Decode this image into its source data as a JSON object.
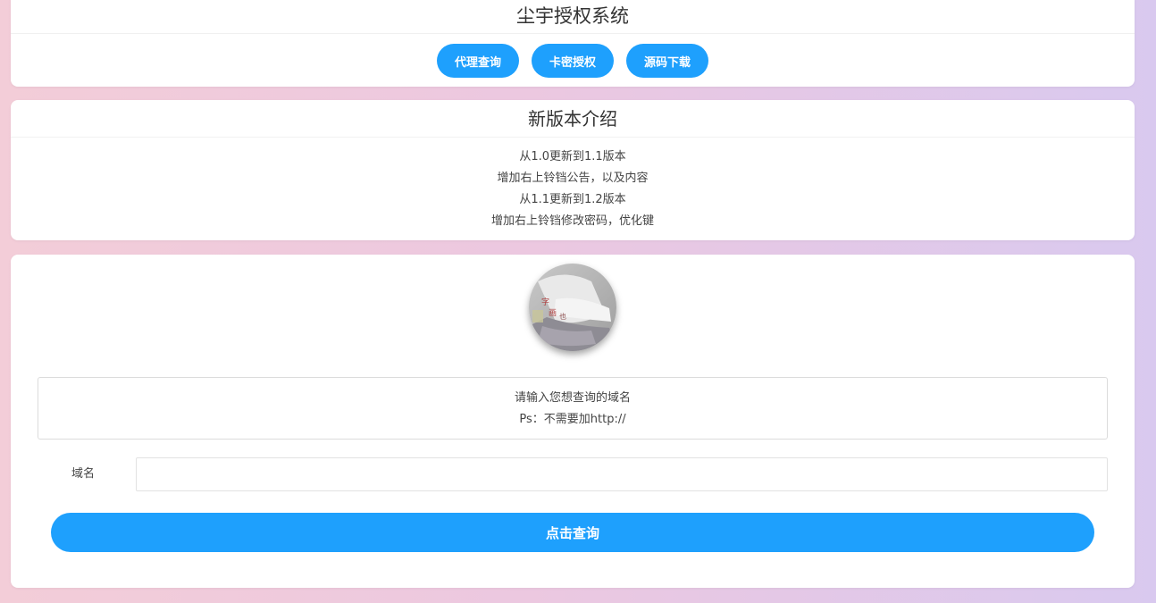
{
  "header": {
    "title": "尘宇授权系统",
    "buttons": [
      "代理查询",
      "卡密授权",
      "源码下载"
    ]
  },
  "intro": {
    "title": "新版本介绍",
    "notes": [
      "从1.0更新到1.1版本",
      "增加右上铃铛公告，以及内容",
      "从1.1更新到1.2版本",
      "增加右上铃铛修改密码，优化键"
    ]
  },
  "query": {
    "hint_line1": "请输入您想查询的域名",
    "hint_line2": "Ps：不需要加http://",
    "field_label": "域名",
    "field_value": "",
    "submit_label": "点击查询"
  },
  "colors": {
    "accent": "#1ea0fd",
    "bg_left": "#f3cdd8",
    "bg_right": "#d9c9ef"
  }
}
